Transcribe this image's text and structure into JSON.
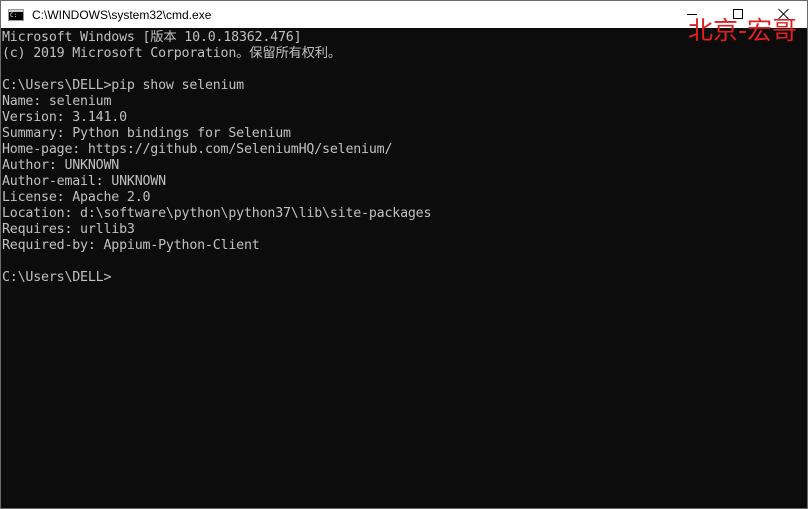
{
  "window": {
    "title": "C:\\WINDOWS\\system32\\cmd.exe"
  },
  "watermark": "北京-宏哥",
  "console": {
    "lines": [
      "Microsoft Windows [版本 10.0.18362.476]",
      "(c) 2019 Microsoft Corporation。保留所有权利。",
      "",
      "C:\\Users\\DELL>pip show selenium",
      "Name: selenium",
      "Version: 3.141.0",
      "Summary: Python bindings for Selenium",
      "Home-page: https://github.com/SeleniumHQ/selenium/",
      "Author: UNKNOWN",
      "Author-email: UNKNOWN",
      "License: Apache 2.0",
      "Location: d:\\software\\python\\python37\\lib\\site-packages",
      "Requires: urllib3",
      "Required-by: Appium-Python-Client",
      "",
      "C:\\Users\\DELL>"
    ]
  },
  "colors": {
    "background": "#0c0c0c",
    "text": "#c0c0c0",
    "watermark": "#e02020",
    "titlebar": "#ffffff"
  }
}
